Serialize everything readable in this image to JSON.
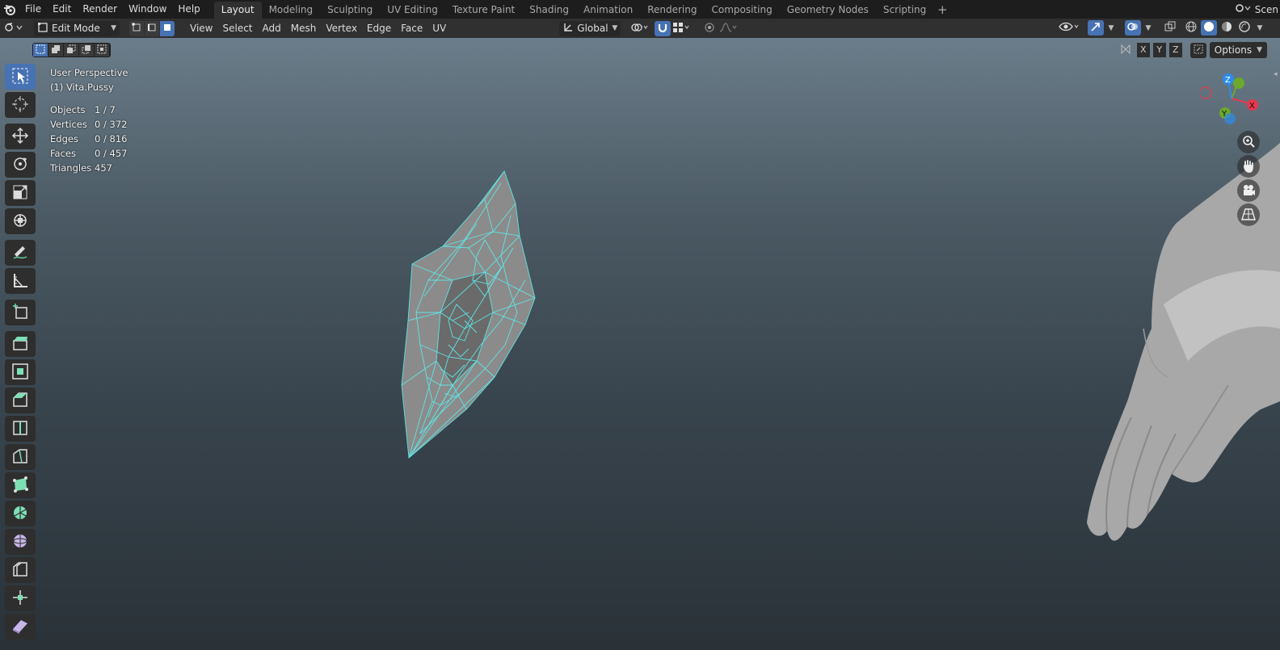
{
  "menubar": {
    "items": [
      "File",
      "Edit",
      "Render",
      "Window",
      "Help"
    ],
    "workspaces": [
      "Layout",
      "Modeling",
      "Sculpting",
      "UV Editing",
      "Texture Paint",
      "Shading",
      "Animation",
      "Rendering",
      "Compositing",
      "Geometry Nodes",
      "Scripting"
    ],
    "active_workspace": "Layout",
    "add_workspace": "+",
    "scene_label": "Scen"
  },
  "header": {
    "mode": "Edit Mode",
    "menus": [
      "View",
      "Select",
      "Add",
      "Mesh",
      "Vertex",
      "Edge",
      "Face",
      "UV"
    ],
    "transform_orientation": "Global"
  },
  "viewport": {
    "view_name": "User Perspective",
    "object_name": "(1) Vita.Pussy",
    "stats": [
      {
        "label": "Objects",
        "value": "1 / 7"
      },
      {
        "label": "Vertices",
        "value": "0 / 372"
      },
      {
        "label": "Edges",
        "value": "0 / 816"
      },
      {
        "label": "Faces",
        "value": "0 / 457"
      },
      {
        "label": "Triangles",
        "value": "457"
      }
    ],
    "axis_x": "X",
    "axis_y": "Y",
    "axis_z": "Z",
    "options_label": "Options"
  },
  "gizmo": {
    "x": "X",
    "y": "Y",
    "z": "Z"
  },
  "colors": {
    "accent": "#4772b3",
    "wire": "#5fe8e8",
    "axis_x": "#e8384f",
    "axis_y": "#6ba82b",
    "axis_z": "#2d8ceb"
  }
}
